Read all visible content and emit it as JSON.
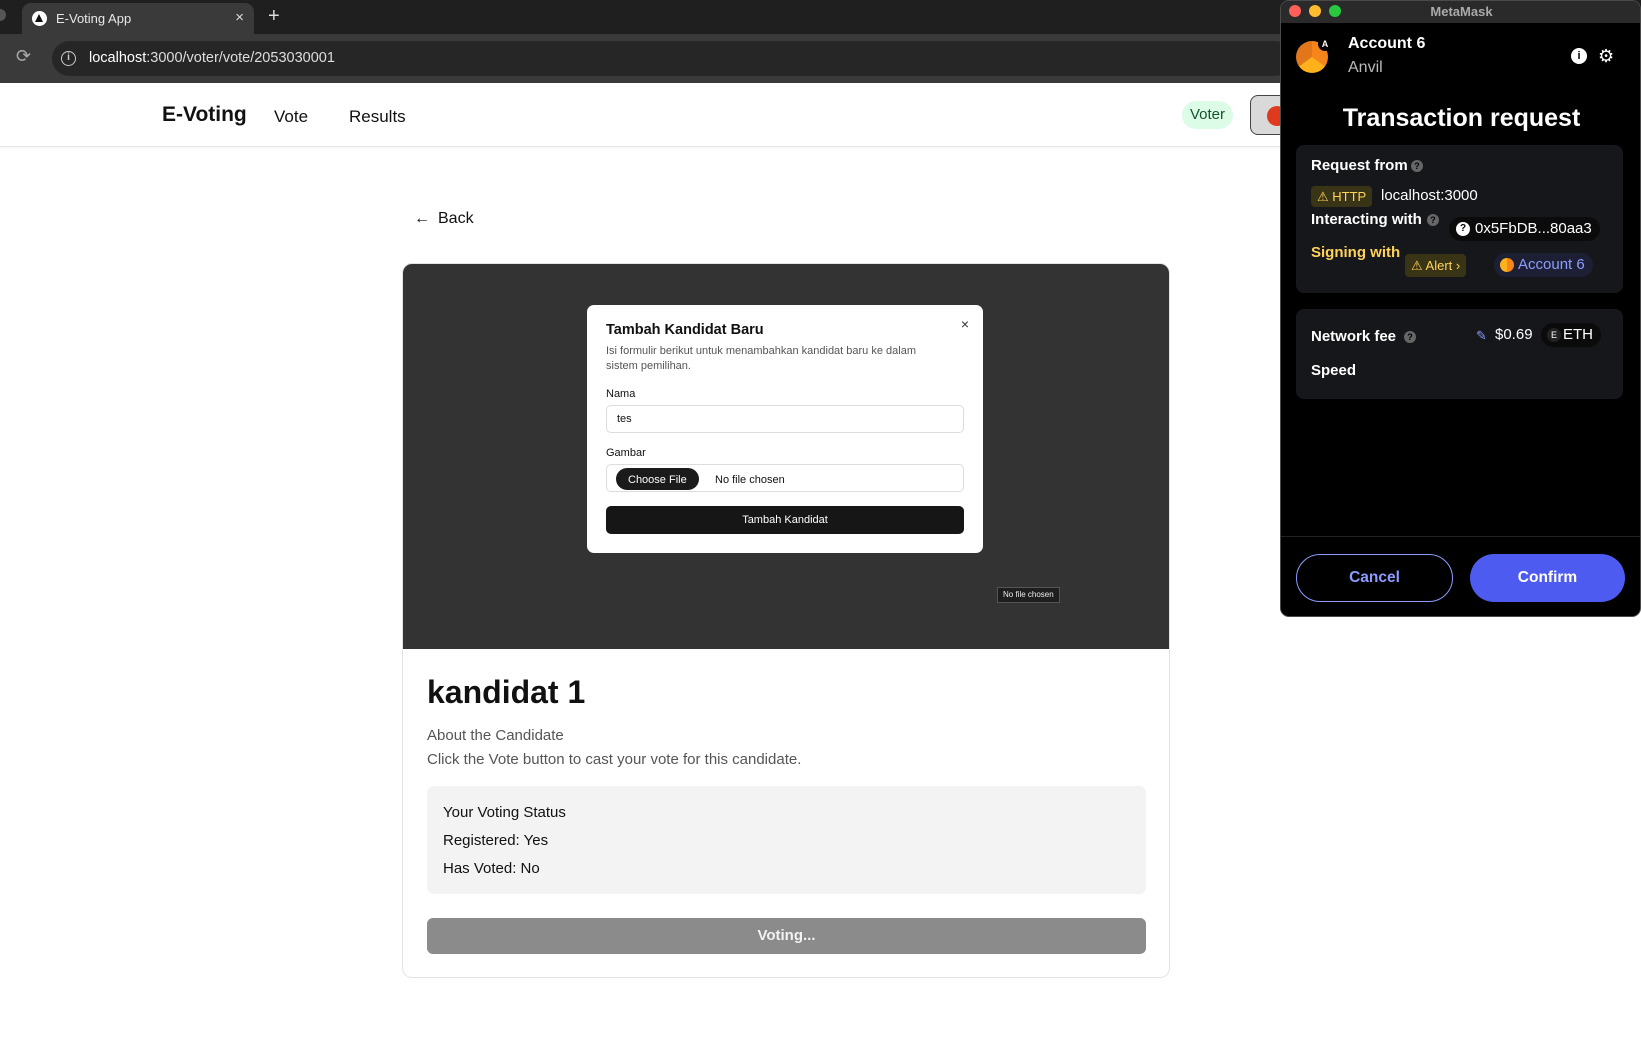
{
  "browser": {
    "tab_title": "E-Voting App",
    "tab_close": "×",
    "new_tab": "+",
    "url_host": "localhost",
    "url_rest": ":3000/voter/vote/2053030001"
  },
  "navbar": {
    "brand": "E-Voting",
    "links": [
      "Vote",
      "Results"
    ],
    "role_badge": "Voter"
  },
  "page": {
    "back_label": "Back",
    "image_modal": {
      "title": "Tambah Kandidat Baru",
      "close": "×",
      "description": "Isi formulir berikut untuk menambahkan kandidat baru ke dalam sistem pemilihan.",
      "name_label": "Nama",
      "name_value": "tes",
      "image_label": "Gambar",
      "choose_file": "Choose File",
      "file_status": "No file chosen",
      "submit": "Tambah Kandidat",
      "tooltip": "No file chosen"
    },
    "candidate_name": "kandidat 1",
    "about_heading": "About the Candidate",
    "about_text": "Click the Vote button to cast your vote for this candidate.",
    "status": {
      "title": "Your Voting Status",
      "registered": "Registered: Yes",
      "has_voted": "Has Voted: No"
    },
    "vote_button": "Voting..."
  },
  "metamask": {
    "window_title": "MetaMask",
    "avatar_badge": "A",
    "account_name": "Account 6",
    "network": "Anvil",
    "heading": "Transaction request",
    "request_from_label": "Request from",
    "http_badge": "⚠ HTTP",
    "origin": "localhost:3000",
    "interacting_label": "Interacting with",
    "contract_address": "0x5FbDB...80aa3",
    "signing_label": "Signing with",
    "alert_label": "⚠ Alert ›",
    "signing_account": "Account 6",
    "network_fee_label": "Network fee",
    "fee_value": "$0.69",
    "fee_currency": "ETH",
    "speed_label": "Speed",
    "cancel": "Cancel",
    "confirm": "Confirm",
    "colors": {
      "accent": "#4e5bf0",
      "warning": "#ffd35a"
    }
  }
}
